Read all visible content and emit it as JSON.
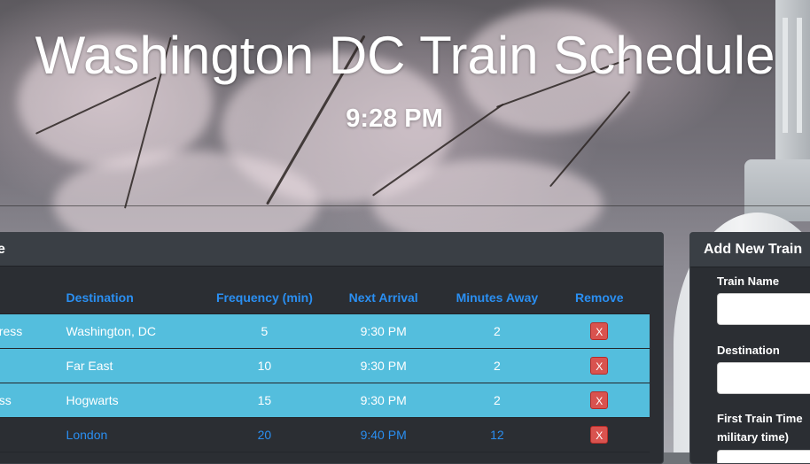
{
  "header": {
    "title": "Washington DC Train Schedule",
    "clock": "9:28 PM"
  },
  "schedule": {
    "heading_fragment": "e",
    "columns": [
      "Destination",
      "Frequency (min)",
      "Next Arrival",
      "Minutes Away",
      "Remove"
    ],
    "rows": [
      {
        "name_fragment": "press",
        "destination": "Washington, DC",
        "frequency": "5",
        "next_arrival": "9:30 PM",
        "minutes_away": "2",
        "remove_label": "X"
      },
      {
        "name_fragment": "",
        "destination": "Far East",
        "frequency": "10",
        "next_arrival": "9:30 PM",
        "minutes_away": "2",
        "remove_label": "X"
      },
      {
        "name_fragment": "ess",
        "destination": "Hogwarts",
        "frequency": "15",
        "next_arrival": "9:30 PM",
        "minutes_away": "2",
        "remove_label": "X"
      },
      {
        "name_fragment": "",
        "destination": "London",
        "frequency": "20",
        "next_arrival": "9:40 PM",
        "minutes_away": "12",
        "remove_label": "X"
      }
    ]
  },
  "add_train": {
    "heading": "Add New Train",
    "train_name_label": "Train Name",
    "destination_label": "Destination",
    "first_train_label_line1": "First Train Time",
    "first_train_label_line2": "military time)"
  },
  "colors": {
    "accent": "#2a8ff2",
    "highlight_row": "#54bedd",
    "remove_button": "#d9534f",
    "panel_bg": "#2b2e33"
  }
}
